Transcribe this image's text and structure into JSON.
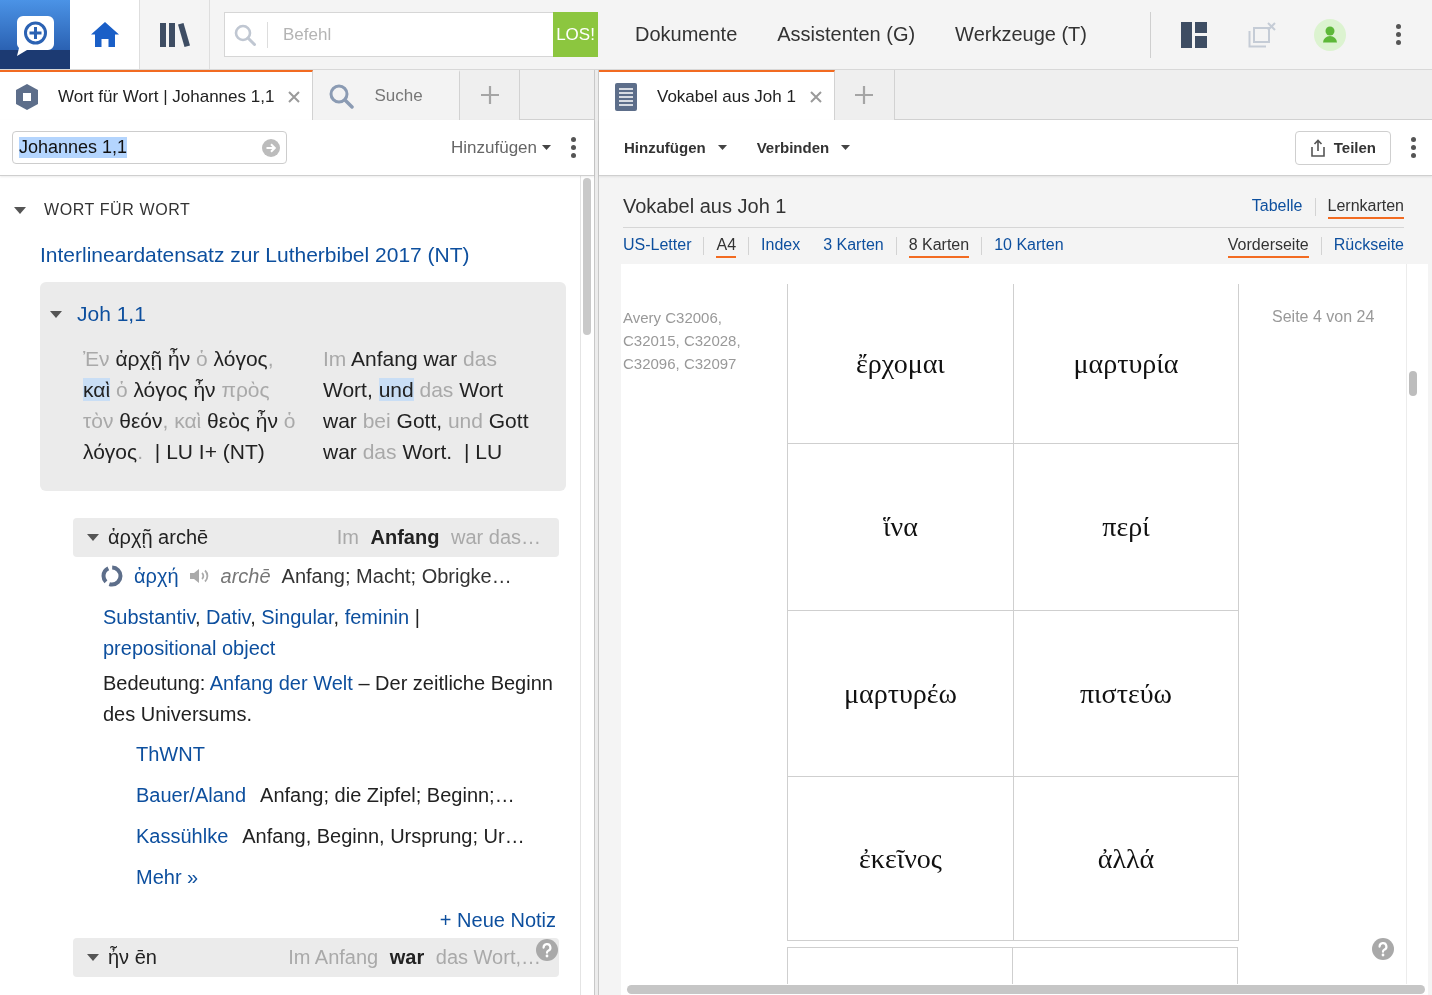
{
  "top_bar": {
    "nav_buttons": [
      {
        "kind": "home",
        "selected": true
      },
      {
        "kind": "library",
        "selected": false
      }
    ],
    "command": {
      "placeholder": "Befehl",
      "button": "LOS!"
    },
    "menus": [
      "Dokumente",
      "Assistenten (G)",
      "Werkzeuge (T)"
    ],
    "tools": [
      {
        "kind": "layout",
        "disabled": false
      },
      {
        "kind": "close_windows",
        "disabled": true
      },
      {
        "kind": "account",
        "disabled": false
      },
      {
        "kind": "more",
        "disabled": false
      }
    ]
  },
  "left_panel": {
    "tabs": [
      {
        "kind": "resource",
        "label": "Wort für Wort | Johannes 1,1",
        "selected": true,
        "closable": true
      },
      {
        "kind": "search",
        "label": "Suche",
        "selected": false,
        "closable": false
      }
    ],
    "reference": {
      "value": "Johannes 1,1",
      "text_selected": true
    },
    "add_menu": "Hinzufügen",
    "section": {
      "title": "WORT FÜR WORT",
      "expanded": true,
      "resource": "Interlineardatensatz zur Lutherbibel 2017 (NT)",
      "verse": {
        "reference": "Joh 1,1",
        "expanded": true,
        "columns": [
          {
            "runs": [
              {
                "text": "Ἐν",
                "kind": "unaligned"
              },
              {
                "text": " ἀρχῇ ἦν ",
                "kind": "word"
              },
              {
                "text": "ὁ",
                "kind": "unaligned"
              },
              {
                "text": " λόγος",
                "kind": "word"
              },
              {
                "text": ", ",
                "kind": "unaligned"
              },
              {
                "text": "καὶ",
                "kind": "highlighted"
              },
              {
                "text": " ὁ ",
                "kind": "unaligned"
              },
              {
                "text": "λόγος ἦν ",
                "kind": "word"
              },
              {
                "text": "πρὸς τὸν",
                "kind": "unaligned"
              },
              {
                "text": " θεόν",
                "kind": "word"
              },
              {
                "text": ", καὶ",
                "kind": "unaligned"
              },
              {
                "text": " θεὸς ἦν ",
                "kind": "word"
              },
              {
                "text": "ὁ",
                "kind": "unaligned"
              },
              {
                "text": " λόγος",
                "kind": "word"
              },
              {
                "text": ".",
                "kind": "unaligned"
              }
            ],
            "source": "| LU I+ (NT)"
          },
          {
            "runs": [
              {
                "text": "Im",
                "kind": "unaligned"
              },
              {
                "text": " Anfang war ",
                "kind": "word"
              },
              {
                "text": "das",
                "kind": "unaligned"
              },
              {
                "text": " Wort, ",
                "kind": "word"
              },
              {
                "text": "und",
                "kind": "highlighted"
              },
              {
                "text": " das ",
                "kind": "unaligned"
              },
              {
                "text": "Wort war ",
                "kind": "word"
              },
              {
                "text": "bei",
                "kind": "unaligned"
              },
              {
                "text": " Gott, ",
                "kind": "word"
              },
              {
                "text": "und",
                "kind": "unaligned"
              },
              {
                "text": " Gott war ",
                "kind": "word"
              },
              {
                "text": "das",
                "kind": "unaligned"
              },
              {
                "text": " Wort.",
                "kind": "word"
              }
            ],
            "source": "| LU"
          }
        ]
      },
      "entries": [
        {
          "heading": "ἀρχῇ archē",
          "expanded": true,
          "context": [
            {
              "text": "Im",
              "kind": "context"
            },
            {
              "text": "Anfang",
              "kind": "match"
            },
            {
              "text": "war das…",
              "kind": "context"
            }
          ],
          "lemma": {
            "word": "ἀρχή",
            "transliteration": "archē",
            "gloss": "Anfang; Macht; Obrigke…"
          },
          "morphology": [
            {
              "text": "Substantiv",
              "kind": "link"
            },
            {
              "text": ", ",
              "kind": "text"
            },
            {
              "text": "Dativ",
              "kind": "link"
            },
            {
              "text": ", ",
              "kind": "text"
            },
            {
              "text": "Singular",
              "kind": "link"
            },
            {
              "text": ", ",
              "kind": "text"
            },
            {
              "text": "feminin",
              "kind": "link"
            },
            {
              "text": " | ",
              "kind": "text"
            },
            {
              "text": "prepositional object",
              "kind": "link"
            }
          ],
          "meaning": [
            {
              "text": "Bedeutung: ",
              "kind": "text"
            },
            {
              "text": "Anfang der Welt",
              "kind": "link"
            },
            {
              "text": " – Der zeitliche Beginn des Universums.",
              "kind": "text"
            }
          ],
          "lexicons": [
            {
              "name": "ThWNT"
            },
            {
              "name": "Bauer/Aland",
              "gloss": "Anfang; die Zipfel; Beginn;…"
            },
            {
              "name": "Kassühlke",
              "gloss": "Anfang, Beginn, Ursprung; Ur…"
            }
          ],
          "more": "Mehr »",
          "note": "+ Neue Notiz"
        },
        {
          "heading": "ἦν ēn",
          "expanded": true,
          "context": [
            {
              "text": "Im Anfang",
              "kind": "context"
            },
            {
              "text": "war",
              "kind": "match"
            },
            {
              "text": "das Wort,…",
              "kind": "context"
            }
          ]
        }
      ]
    }
  },
  "right_panel": {
    "tabs": [
      {
        "kind": "document",
        "label": "Vokabel aus Joh 1",
        "selected": true,
        "closable": true
      }
    ],
    "toolbar": {
      "menus": [
        "Hinzufügen",
        "Verbinden"
      ],
      "share": "Teilen"
    },
    "document": {
      "title": "Vokabel aus Joh 1",
      "views": [
        {
          "label": "Tabelle",
          "selected": false
        },
        {
          "label": "Lernkarten",
          "selected": true
        }
      ],
      "option_groups": [
        [
          {
            "label": "US-Letter",
            "selected": false
          },
          {
            "label": "A4",
            "selected": true
          },
          {
            "label": "Index",
            "selected": false
          }
        ],
        [
          {
            "label": "3 Karten",
            "selected": false
          },
          {
            "label": "8 Karten",
            "selected": true
          },
          {
            "label": "10 Karten",
            "selected": false
          }
        ],
        [
          {
            "label": "Vorderseite",
            "selected": true
          },
          {
            "label": "Rückseite",
            "selected": false
          }
        ]
      ],
      "label_note": "Avery C32006, C32015, C32028, C32096, C32097",
      "page_label": "Seite 4 von 24",
      "cards": [
        "ἔρχομαι",
        "μαρτυρία",
        "ἵνα",
        "περί",
        "μαρτυρέω",
        "πιστεύω",
        "ἐκεῖνος",
        "ἀλλά"
      ]
    }
  }
}
